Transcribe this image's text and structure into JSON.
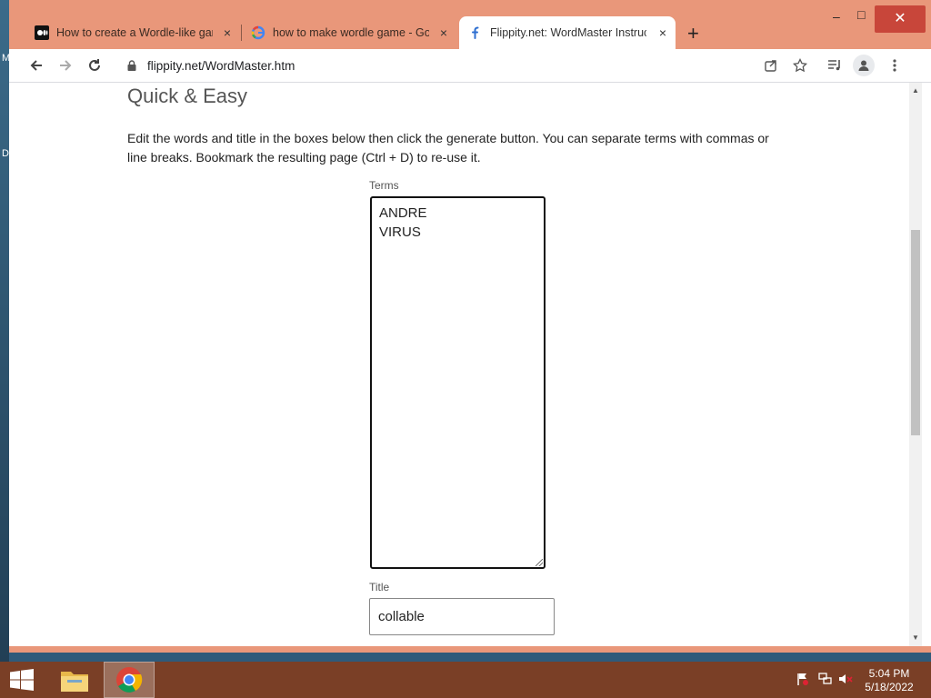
{
  "desktop": {
    "edge_letters": [
      "M",
      "D"
    ]
  },
  "tabs": [
    {
      "label": "How to create a Wordle-like game",
      "icon": "medium-favicon",
      "close": "×",
      "active": false
    },
    {
      "label": "how to make wordle game - Google",
      "icon": "google-favicon",
      "close": "×",
      "active": false
    },
    {
      "label": "Flippity.net: WordMaster Instructions",
      "icon": "flippity-favicon",
      "close": "×",
      "active": true
    }
  ],
  "window_controls": {
    "minimize": "–",
    "maximize": "□",
    "close": "✕"
  },
  "toolbar": {
    "url": "flippity.net/WordMaster.htm"
  },
  "page": {
    "heading": "Quick & Easy",
    "instructions": "Edit the words and title in the boxes below then click the generate button. You can separate terms with commas or line breaks. Bookmark the resulting page (Ctrl + D) to re-use it.",
    "terms_label": "Terms",
    "terms": [
      "ANDRE",
      "VIRUS"
    ],
    "title_label": "Title",
    "title_value": "collable"
  },
  "taskbar": {
    "time": "5:04 PM",
    "date": "5/18/2022"
  },
  "colors": {
    "chrome_frame": "#e9977a",
    "taskbar": "#7a3f26",
    "close_red": "#c8463a"
  }
}
